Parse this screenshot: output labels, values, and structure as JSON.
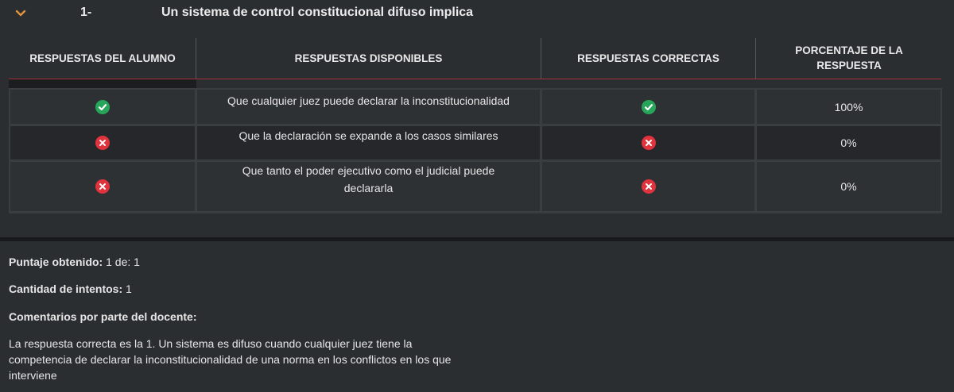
{
  "question": {
    "number": "1-",
    "title": "Un sistema de control constitucional difuso implica"
  },
  "table": {
    "headers": {
      "student": "RESPUESTAS DEL ALUMNO",
      "available": "RESPUESTAS DISPONIBLES",
      "correct": "RESPUESTAS CORRECTAS",
      "percent_line1": "PORCENTAJE DE LA",
      "percent_line2": "RESPUESTA"
    },
    "rows": [
      {
        "student_icon": "check-circle-icon",
        "answer": "Que cualquier juez puede declarar la inconstitucionalidad",
        "correct_icon": "check-circle-icon",
        "percent": "100%"
      },
      {
        "student_icon": "x-circle-icon",
        "answer": "Que la declaración se expande a los casos similares",
        "correct_icon": "x-circle-icon",
        "percent": "0%"
      },
      {
        "student_icon": "x-circle-icon",
        "answer_line1": "Que tanto el poder ejecutivo como el judicial puede",
        "answer_line2": "declararla",
        "correct_icon": "x-circle-icon",
        "percent": "0%"
      }
    ]
  },
  "summary": {
    "score_label": "Puntaje obtenido:",
    "score_value": "1 de: 1",
    "attempts_label": "Cantidad de intentos:",
    "attempts_value": "1",
    "comments_label": "Comentarios por parte del docente:",
    "comment_line1": "La respuesta correcta es la 1. Un sistema es difuso cuando cualquier juez tiene la",
    "comment_line2": "competencia de declarar la inconstitucionalidad de una norma en los conflictos en los que",
    "comment_line3": "interviene"
  },
  "colors": {
    "accent_chevron": "#e0933c",
    "check_green": "#27a55a",
    "x_red": "#e0333d",
    "header_rule": "#a3303a"
  }
}
